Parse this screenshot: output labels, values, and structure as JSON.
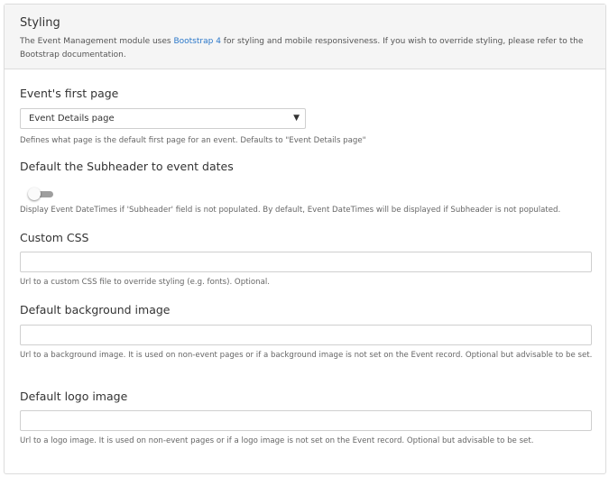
{
  "header": {
    "title": "Styling",
    "description_before": "The Event Management module uses ",
    "description_link": "Bootstrap 4",
    "description_after": " for styling and mobile responsiveness. If you wish to override styling, please refer to the Bootstrap documentation."
  },
  "first_page": {
    "label": "Event's first page",
    "selected": "Event Details page",
    "help": "Defines what page is the default first page for an event. Defaults to \"Event Details page\""
  },
  "subheader": {
    "label": "Default the Subheader to event dates",
    "toggle_on": false,
    "help": "Display Event DateTimes if 'Subheader' field is not populated. By default, Event DateTimes will be displayed if Subheader is not populated."
  },
  "custom_css": {
    "label": "Custom CSS",
    "value": "",
    "help": "Url to a custom CSS file to override styling (e.g. fonts). Optional."
  },
  "background_image": {
    "label": "Default background image",
    "value": "",
    "help": "Url to a background image. It is used on non-event pages or if a background image is not set on the Event record. Optional but advisable to be set."
  },
  "logo_image": {
    "label": "Default logo image",
    "value": "",
    "help": "Url to a logo image. It is used on non-event pages or if a logo image is not set on the Event record. Optional but advisable to be set."
  },
  "colors": {
    "link": "#2a77c9",
    "header_bg": "#f5f5f5",
    "toggle_track": "#9e9e9e"
  },
  "icons": {
    "select_caret": "caret-down-icon"
  }
}
